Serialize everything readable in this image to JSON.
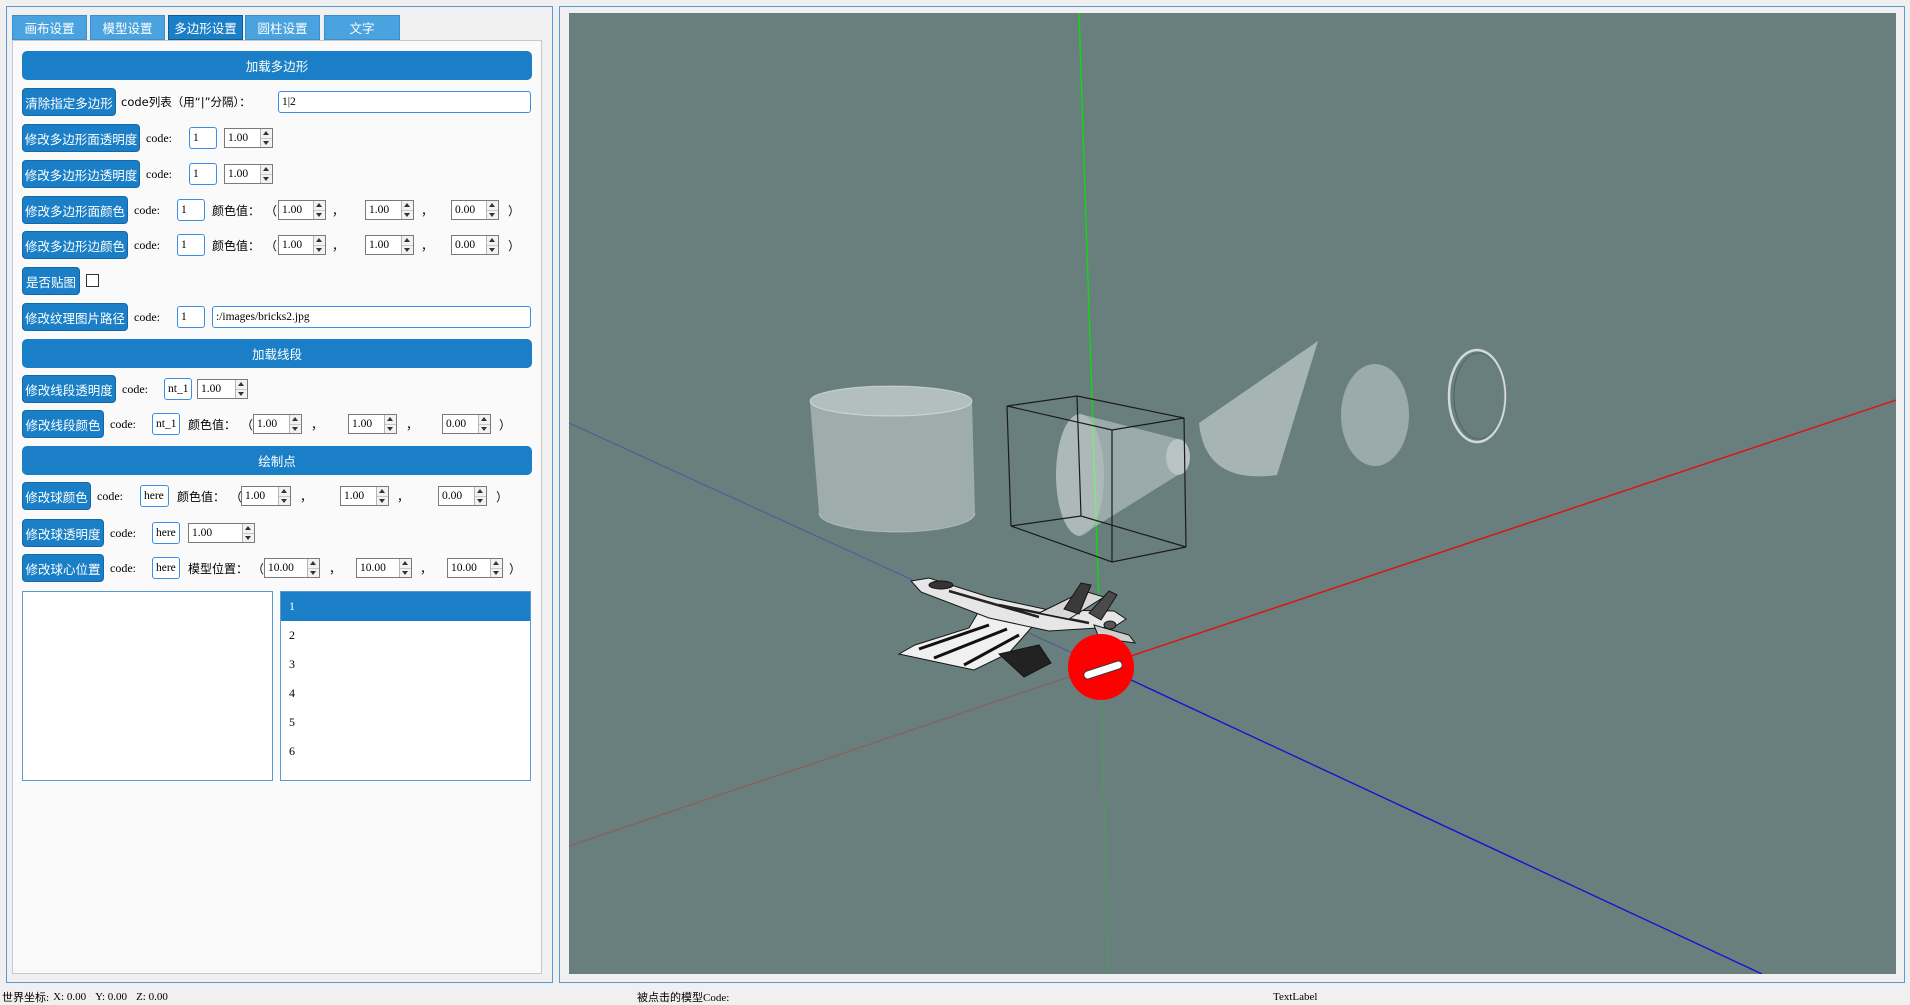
{
  "colors": {
    "accent": "#1a7fc6",
    "tab": "#4aa3df",
    "viewport": "#687f7e",
    "axis_x": "#e01010",
    "axis_y": "#12d812",
    "axis_z": "#1414d0",
    "sphere": "#ff0000"
  },
  "tabs": [
    "画布设置",
    "模型设置",
    "多边形设置",
    "圆柱设置",
    "文字"
  ],
  "active_tab_index": 2,
  "punct": {
    "open": "（",
    "sep": "，",
    "close": "）"
  },
  "polygon": {
    "title": "加载多边形",
    "clear": {
      "button": "清除指定多边形",
      "label": "code列表（用“|”分隔）：",
      "value": "1|2"
    },
    "face_opacity": {
      "button": "修改多边形面透明度",
      "code_label": "code:",
      "code": "1",
      "value": "1.00"
    },
    "edge_opacity": {
      "button": "修改多边形边透明度",
      "code_label": "code:",
      "code": "1",
      "value": "1.00"
    },
    "face_color": {
      "button": "修改多边形面颜色",
      "code_label": "code:",
      "code": "1",
      "color_label": "颜色值：",
      "r": "1.00",
      "g": "1.00",
      "b": "0.00"
    },
    "edge_color": {
      "button": "修改多边形边颜色",
      "code_label": "code:",
      "code": "1",
      "color_label": "颜色值：",
      "r": "1.00",
      "g": "1.00",
      "b": "0.00"
    },
    "texture": {
      "button": "是否贴图",
      "checked": false
    },
    "texture_path": {
      "button": "修改纹理图片路径",
      "code_label": "code:",
      "code": "1",
      "value": ":/images/bricks2.jpg"
    }
  },
  "lines": {
    "title": "加载线段",
    "opacity": {
      "button": "修改线段透明度",
      "code_label": "code:",
      "code": "nt_1",
      "value": "1.00"
    },
    "color": {
      "button": "修改线段颜色",
      "code_label": "code:",
      "code": "nt_1",
      "color_label": "颜色值：",
      "r": "1.00",
      "g": "1.00",
      "b": "0.00"
    }
  },
  "points": {
    "title": "绘制点",
    "color": {
      "button": "修改球颜色",
      "code_label": "code:",
      "code": "here",
      "color_label": "颜色值：",
      "r": "1.00",
      "g": "1.00",
      "b": "0.00"
    },
    "opacity": {
      "button": "修改球透明度",
      "code_label": "code:",
      "code": "here",
      "value": "1.00"
    },
    "position": {
      "button": "修改球心位置",
      "code_label": "code:",
      "code": "here",
      "position_label": "模型位置：",
      "x": "10.00",
      "y": "10.00",
      "z": "10.00"
    }
  },
  "right_list": {
    "items": [
      "1",
      "2",
      "3",
      "4",
      "5",
      "6"
    ],
    "selected_index": 0
  },
  "status": {
    "world_label": "世界坐标:",
    "x": "X: 0.00",
    "y": "Y: 0.00",
    "z": "Z: 0.00",
    "clicked_label": "被点击的模型Code:",
    "text_label": "TextLabel"
  }
}
